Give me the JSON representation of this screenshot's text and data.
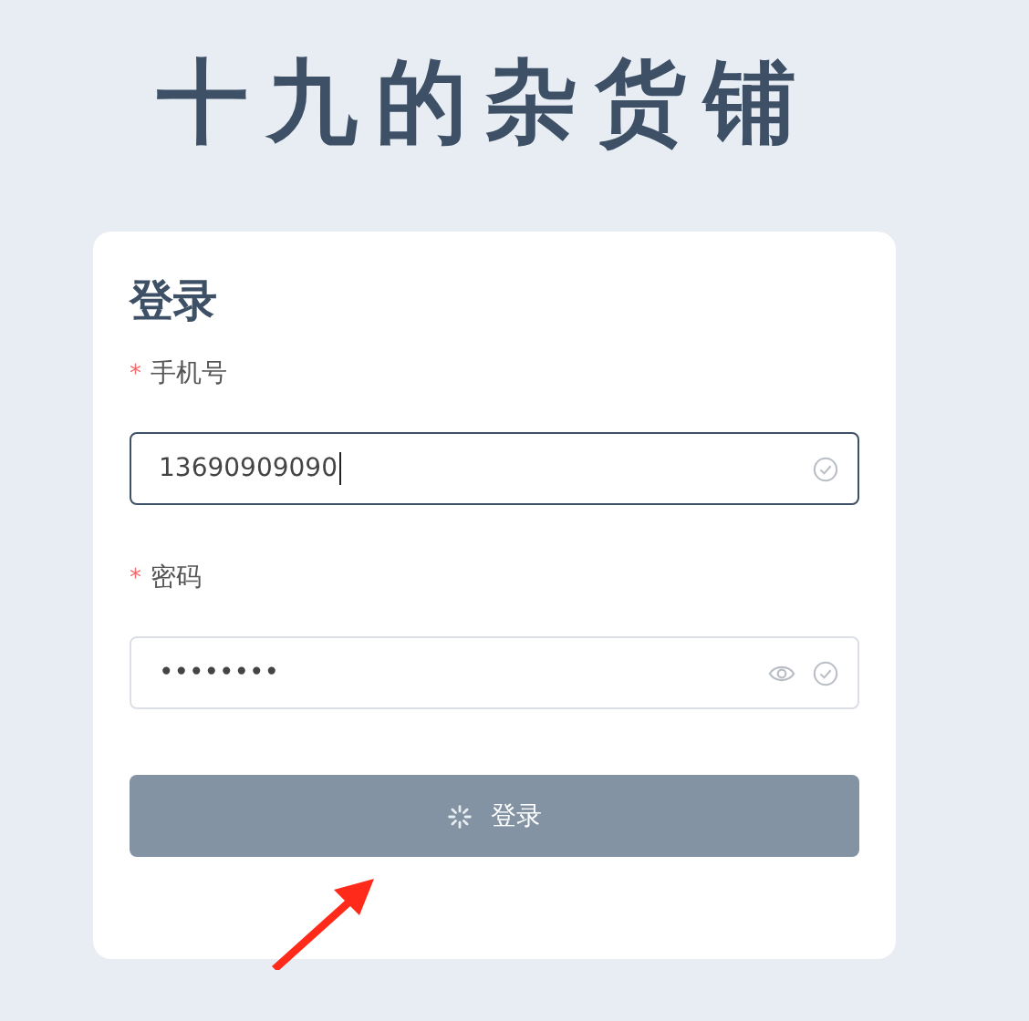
{
  "brand": {
    "title": "十九的杂货铺"
  },
  "login": {
    "heading": "登录",
    "fields": [
      {
        "kind": "text",
        "label": "手机号",
        "required_mark": "*",
        "value": "13690909090",
        "focused": true,
        "valid": true
      },
      {
        "kind": "password",
        "label": "密码",
        "required_mark": "*",
        "value": "••••••••",
        "focused": false,
        "valid": true
      }
    ],
    "submit": {
      "label": "登录",
      "loading": true
    }
  }
}
